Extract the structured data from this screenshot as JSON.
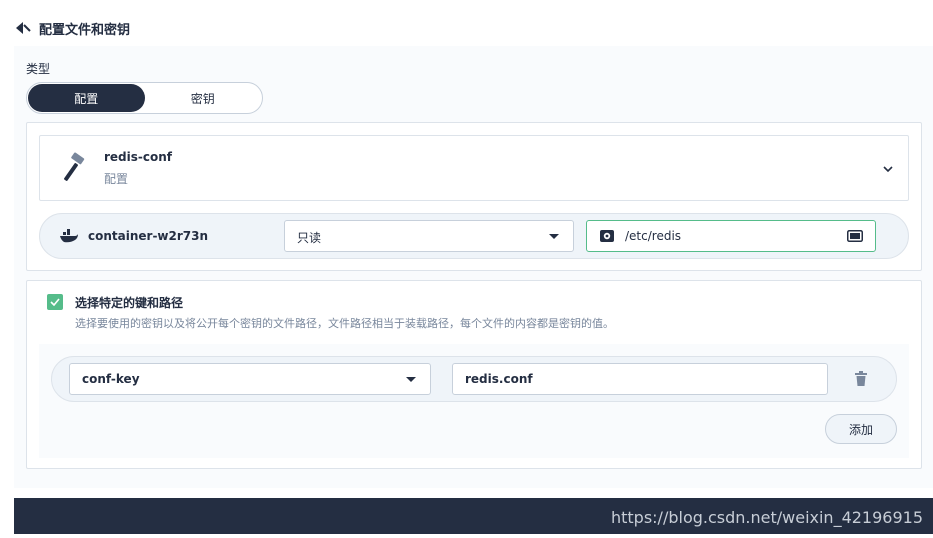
{
  "header": {
    "title": "配置文件和密钥"
  },
  "type": {
    "label": "类型",
    "options": [
      {
        "label": "配置",
        "active": true
      },
      {
        "label": "密钥",
        "active": false
      }
    ]
  },
  "source": {
    "name": "redis-conf",
    "type": "配置"
  },
  "mount": {
    "container": "container-w2r73n",
    "mode": "只读",
    "path": "/etc/redis"
  },
  "keys": {
    "checked": true,
    "title": "选择特定的键和路径",
    "description": "选择要使用的密钥以及将公开每个密钥的文件路径，文件路径相当于装载路径，每个文件的内容都是密钥的值。",
    "items": [
      {
        "key": "conf-key",
        "path": "redis.conf"
      }
    ],
    "add_label": "添加"
  },
  "watermark": "https://blog.csdn.net/weixin_42196915",
  "colors": {
    "accent": "#55bc8a",
    "dark": "#242e42",
    "muted": "#79879c"
  }
}
